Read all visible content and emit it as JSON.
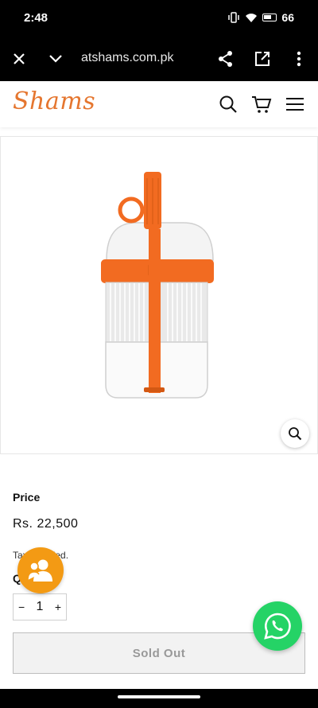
{
  "status": {
    "time": "2:48",
    "battery": "66"
  },
  "browser": {
    "url": "atshams.com.pk"
  },
  "site": {
    "logo": "Shams"
  },
  "product": {
    "price_label": "Price",
    "price": "Rs. 22,500",
    "tax_note": "Tax included.",
    "quantity_label": "Quantity",
    "quantity": "1",
    "minus": "−",
    "plus": "+",
    "sold_out_label": "Sold Out"
  },
  "icons": [
    "close-icon",
    "chevron-down-icon",
    "share-icon",
    "open-external-icon",
    "more-icon",
    "search-icon",
    "cart-icon",
    "menu-icon",
    "zoom-icon",
    "contact-icon",
    "whatsapp-icon"
  ],
  "colors": {
    "brand": "#e5762f",
    "product_orange": "#f26b21",
    "contact": "#f39a14",
    "whatsapp": "#25d366"
  }
}
